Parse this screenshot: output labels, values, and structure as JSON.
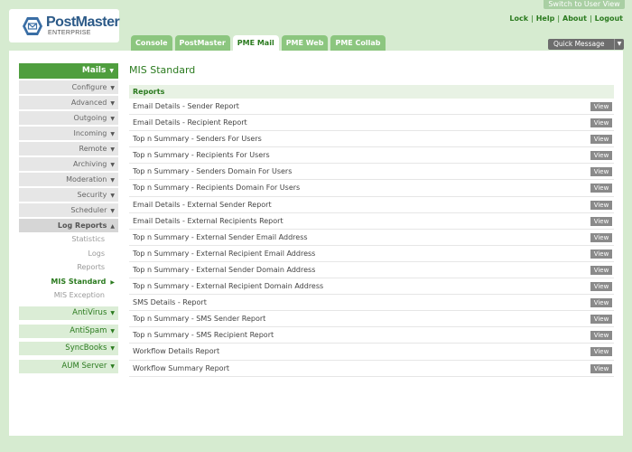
{
  "header": {
    "switch_label": "Switch to User View",
    "logo": {
      "title": "PostMaster",
      "subtitle": "ENTERPRISE"
    },
    "links": [
      "Lock",
      "Help",
      "About",
      "Logout"
    ],
    "tabs": [
      {
        "label": "Console",
        "active": false
      },
      {
        "label": "PostMaster",
        "active": false
      },
      {
        "label": "PME Mail",
        "active": true
      },
      {
        "label": "PME Web",
        "active": false
      },
      {
        "label": "PME Collab",
        "active": false
      }
    ],
    "quick_message": "Quick Message"
  },
  "sidebar": {
    "section_title": "Mails",
    "items": [
      "Configure",
      "Advanced",
      "Outgoing",
      "Incoming",
      "Remote",
      "Archiving",
      "Moderation",
      "Security",
      "Scheduler"
    ],
    "open_item": "Log Reports",
    "subitems": [
      "Statistics",
      "Logs",
      "Reports",
      "MIS Standard",
      "MIS Exception"
    ],
    "active_subitem": "MIS Standard",
    "modules": [
      "AntiVirus",
      "AntiSpam",
      "SyncBooks",
      "AUM Server"
    ]
  },
  "main": {
    "title": "MIS Standard",
    "section_header": "Reports",
    "view_label": "View",
    "reports": [
      "Email Details - Sender Report",
      "Email Details - Recipient Report",
      "Top n Summary - Senders For Users",
      "Top n Summary - Recipients For Users",
      "Top n Summary - Senders Domain For Users",
      "Top n Summary - Recipients Domain For Users",
      "Email Details - External Sender Report",
      "Email Details - External Recipients Report",
      "Top n Summary - External Sender Email Address",
      "Top n Summary - External Recipient Email Address",
      "Top n Summary - External Sender Domain Address",
      "Top n Summary - External Recipient Domain Address",
      "SMS Details - Report",
      "Top n Summary - SMS Sender Report",
      "Top n Summary - SMS Recipient Report",
      "Workflow Details Report",
      "Workflow Summary Report"
    ]
  },
  "colors": {
    "background": "#d6ebd0",
    "accent_green": "#4f9e3e",
    "tab_green": "#8cc67f",
    "link_green": "#2a7a1e",
    "view_button": "#8a8a8a"
  }
}
